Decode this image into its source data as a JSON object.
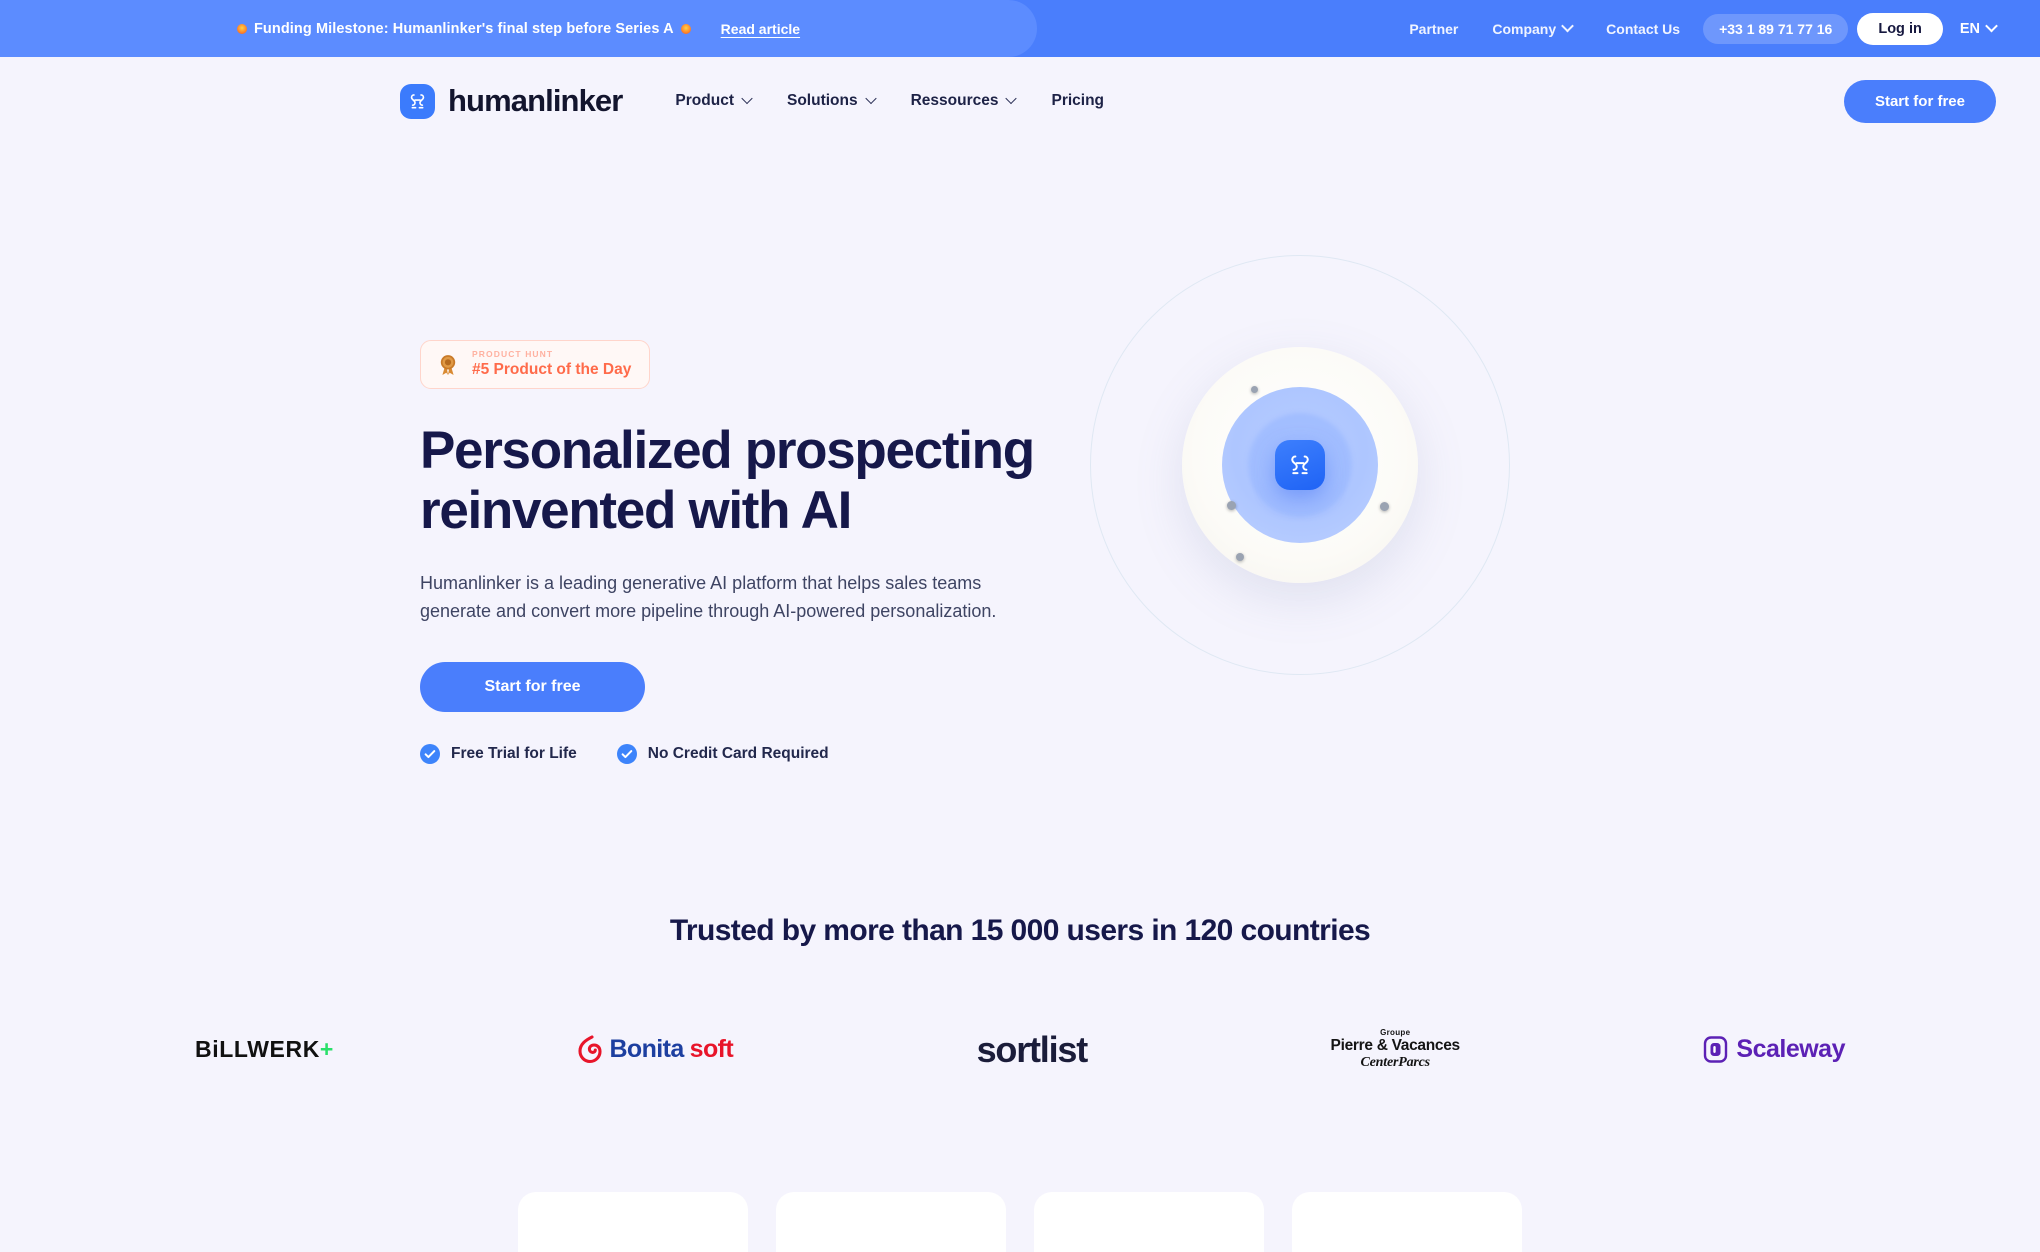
{
  "announcement": {
    "text": "Funding Milestone: Humanlinker's final step before Series A",
    "link_label": "Read article",
    "spark_icon": "spark-icon"
  },
  "topbar": {
    "links": [
      {
        "label": "Partner",
        "has_dropdown": false
      },
      {
        "label": "Company",
        "has_dropdown": true
      },
      {
        "label": "Contact Us",
        "has_dropdown": false
      }
    ],
    "phone": "+33 1 89 71 77 16",
    "login_label": "Log in",
    "language": "EN"
  },
  "nav": {
    "brand": "humanlinker",
    "brand_icon": "humanlinker-logo-icon",
    "links": [
      {
        "label": "Product",
        "has_dropdown": true
      },
      {
        "label": "Solutions",
        "has_dropdown": true
      },
      {
        "label": "Ressources",
        "has_dropdown": true
      },
      {
        "label": "Pricing",
        "has_dropdown": false
      }
    ],
    "cta_label": "Start for free"
  },
  "hero": {
    "badge": {
      "kicker": "PRODUCT HUNT",
      "title": "#5 Product of the Day",
      "icon": "medal-icon"
    },
    "heading": "Personalized prospecting reinvented with AI",
    "subheading": "Humanlinker is a leading generative AI platform that helps sales teams generate and convert more pipeline through AI-powered personalization.",
    "cta_label": "Start for free",
    "features": [
      {
        "label": "Free Trial for Life",
        "icon": "check-circle-icon"
      },
      {
        "label": "No Credit Card Required",
        "icon": "check-circle-icon"
      }
    ],
    "illustration": "humanlinker-orb-illustration"
  },
  "trusted": {
    "heading": "Trusted by more than 15 000 users in 120 countries",
    "logos": [
      {
        "name": "billwerk-plus-logo",
        "text": "BiLLWERK",
        "accent": "+"
      },
      {
        "name": "bonitasoft-logo",
        "text_primary": "Bonita",
        "text_secondary": "soft"
      },
      {
        "name": "sortlist-logo",
        "text": "sortlist"
      },
      {
        "name": "pierre-vacances-centerparcs-logo",
        "line1": "Groupe",
        "line2": "Pierre & Vacances",
        "line3": "CenterParcs"
      },
      {
        "name": "scaleway-logo",
        "text": "Scaleway"
      }
    ]
  },
  "colors": {
    "page_bg": "#f5f4fd",
    "brand_blue": "#4a7efc",
    "banner_blue": "#5c8cff",
    "navy": "#16184a",
    "product_hunt_orange": "#ff6b4a",
    "billwerk_green": "#2ae06a",
    "bonita_blue": "#1d3fa0",
    "bonita_red": "#e8152a",
    "scaleway_purple": "#5c21b5"
  }
}
